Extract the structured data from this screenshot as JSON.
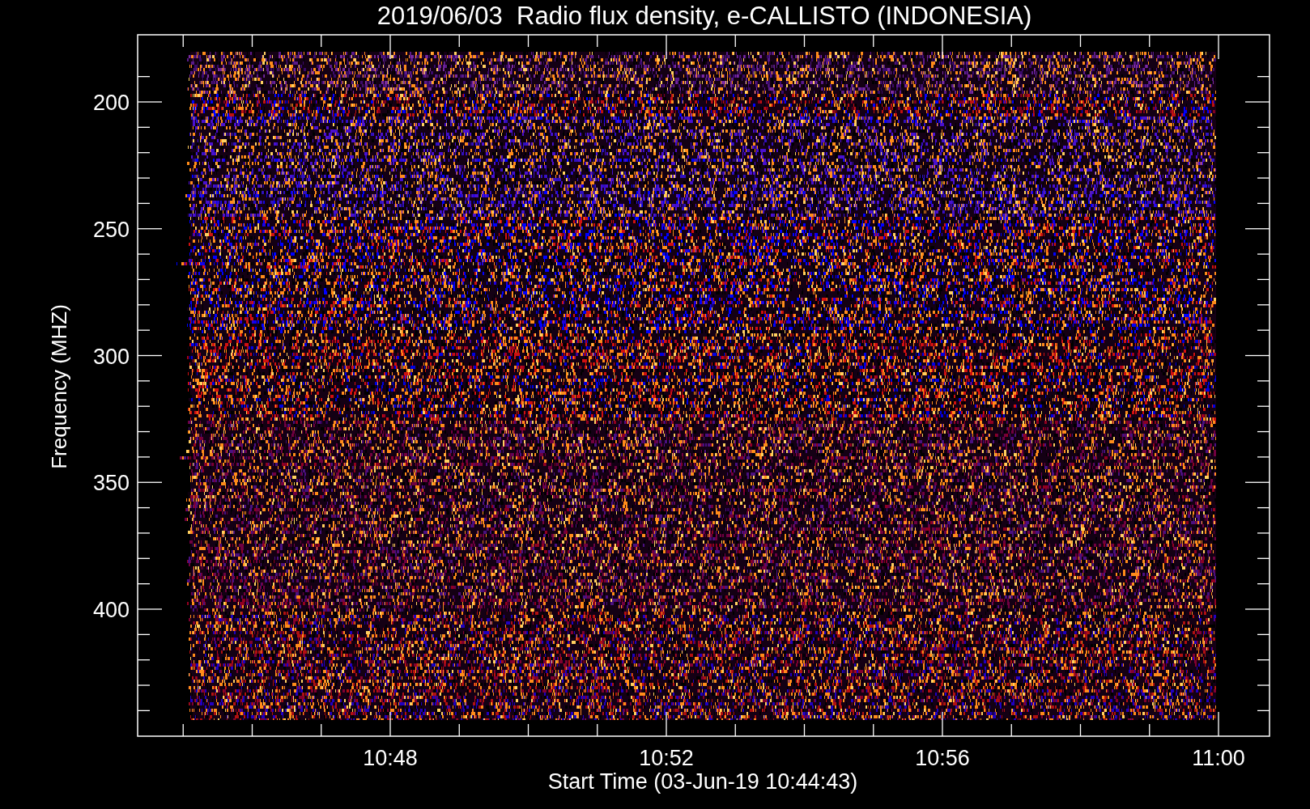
{
  "title": "2019/06/03  Radio flux density, e-CALLISTO (INDONESIA)",
  "y_axis": {
    "label": "Frequency (MHZ)",
    "ticks": [
      "200",
      "250",
      "300",
      "350",
      "400"
    ]
  },
  "x_axis": {
    "label": "Start Time (03-Jun-19 10:44:43)",
    "ticks": [
      "10:48",
      "10:52",
      "10:56",
      "11:00"
    ]
  }
}
